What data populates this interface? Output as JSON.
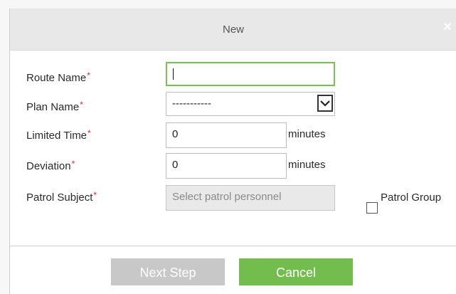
{
  "dialog": {
    "title": "New",
    "close_glyph": "×"
  },
  "form": {
    "required_marker": "*",
    "route_name": {
      "label": "Route Name",
      "value": ""
    },
    "plan_name": {
      "label": "Plan Name",
      "value": "-----------"
    },
    "limited_time": {
      "label": "Limited Time",
      "value": "0",
      "unit": "minutes"
    },
    "deviation": {
      "label": "Deviation",
      "value": "0",
      "unit": "minutes"
    },
    "patrol_subject": {
      "label": "Patrol Subject",
      "placeholder": "Select patrol personnel"
    },
    "patrol_group": {
      "label": "Patrol Group",
      "checked": false
    }
  },
  "footer": {
    "next_label": "Next Step",
    "cancel_label": "Cancel"
  },
  "colors": {
    "accent_green": "#73bd4f",
    "required_red": "#e2262b",
    "disabled_gray": "#c8c8c8"
  },
  "icons": {
    "close": "close-icon",
    "dropdown": "chevron-down-icon",
    "checkbox": "checkbox-icon"
  }
}
